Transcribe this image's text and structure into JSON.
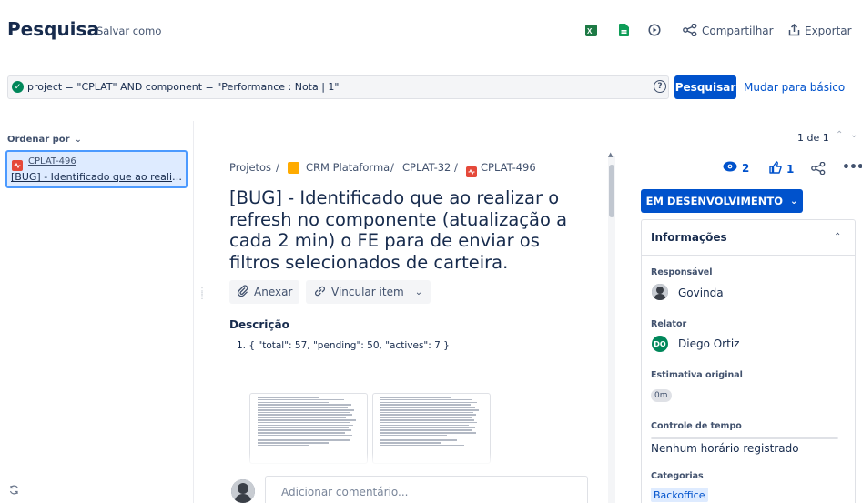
{
  "header": {
    "title": "Pesquisa",
    "save_as": "Salvar como",
    "share": "Compartilhar",
    "export": "Exportar",
    "icons": [
      "excel-icon",
      "sheets-icon",
      "history-icon",
      "share-icon",
      "export-icon"
    ]
  },
  "jql": {
    "query": "project = \"CPLAT\" AND component = \"Performance : Nota | 1\"",
    "search_button": "Pesquisar",
    "basic_link": "Mudar para básico",
    "status_color": "#00875a"
  },
  "left_panel": {
    "sort_label": "Ordenar por",
    "issues": [
      {
        "key": "CPLAT-496",
        "summary": "[BUG] - Identificado que ao realizar o refresh no componente (atualização a cada 2 min) o FE para de enviar os filtros selecionados de carteira."
      }
    ]
  },
  "pagination": {
    "text": "1 de 1"
  },
  "breadcrumb": {
    "projects": "Projetos",
    "project": "CRM Plataforma",
    "parent": "CPLAT-32",
    "issue": "CPLAT-496",
    "sep": "/"
  },
  "issue": {
    "title": "[BUG] - Identificado que ao realizar o refresh no componente (atualização a cada 2 min) o FE para de enviar os filtros selecionados de carteira.",
    "attach": "Anexar",
    "link_item": "Vincular item",
    "description_label": "Descrição",
    "description_line": "1. { \"total\": 57, \"pending\": 50, \"actives\": 7 }",
    "comment_placeholder": "Adicionar comentário..."
  },
  "right_panel": {
    "watchers": "2",
    "votes": "1",
    "status": "EM DESENVOLVIMENTO",
    "info_title": "Informações",
    "fields": {
      "assignee_label": "Responsável",
      "assignee": "Govinda",
      "reporter_label": "Relator",
      "reporter": "Diego Ortiz",
      "reporter_initials": "DO",
      "estimate_label": "Estimativa original",
      "estimate": "0m",
      "time_label": "Controle de tempo",
      "time_value": "Nenhum horário registrado",
      "categories_label": "Categorias",
      "category": "Backoffice"
    }
  },
  "colors": {
    "accent": "#0052cc",
    "bug": "#e5493a",
    "project": "#ffab00"
  }
}
